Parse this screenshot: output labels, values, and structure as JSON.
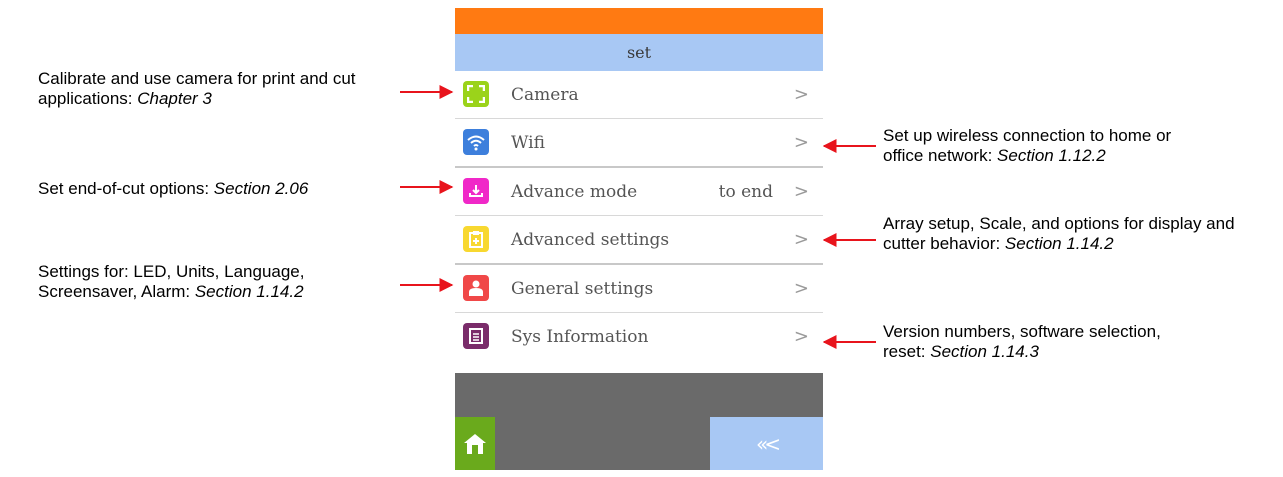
{
  "screen": {
    "title": "set",
    "items": [
      {
        "label": "Camera",
        "value": "",
        "icon": "camera-frame-icon",
        "color": "#9bd31a"
      },
      {
        "label": "Wifi",
        "value": "",
        "icon": "wifi-icon",
        "color": "#3d7fdc"
      },
      {
        "label": "Advance mode",
        "value": "to end",
        "icon": "download-tray-icon",
        "color": "#f028c8"
      },
      {
        "label": "Advanced settings",
        "value": "",
        "icon": "clipboard-plus-icon",
        "color": "#f8d830"
      },
      {
        "label": "General settings",
        "value": "",
        "icon": "user-icon",
        "color": "#f04848"
      },
      {
        "label": "Sys Information",
        "value": "",
        "icon": "info-list-icon",
        "color": "#7a2c6a"
      }
    ],
    "chevron": ">",
    "back_label": "«<",
    "home_icon": "home-icon"
  },
  "annotations": {
    "camera": {
      "text": "Calibrate and use camera for print and cut applications: ",
      "ref": "Chapter 3"
    },
    "advance": {
      "text": "Set end-of-cut options: ",
      "ref": "Section 2.06"
    },
    "general": {
      "text": "Settings for: LED, Units, Language, Screensaver, Alarm: ",
      "ref": "Section 1.14.2"
    },
    "wifi": {
      "text": "Set up wireless connection to home or office network: ",
      "ref": "Section 1.12.2"
    },
    "advanced": {
      "text": "Array setup, Scale, and options for display and cutter behavior: ",
      "ref": "Section 1.14.2"
    },
    "sysinfo": {
      "text": "Version numbers, software selection, reset: ",
      "ref": "Section 1.14.3"
    }
  },
  "colors": {
    "arrow": "#e8141c",
    "topbar": "#ff7a12",
    "titlebar": "#a8c8f4",
    "home": "#6aaa1c"
  }
}
